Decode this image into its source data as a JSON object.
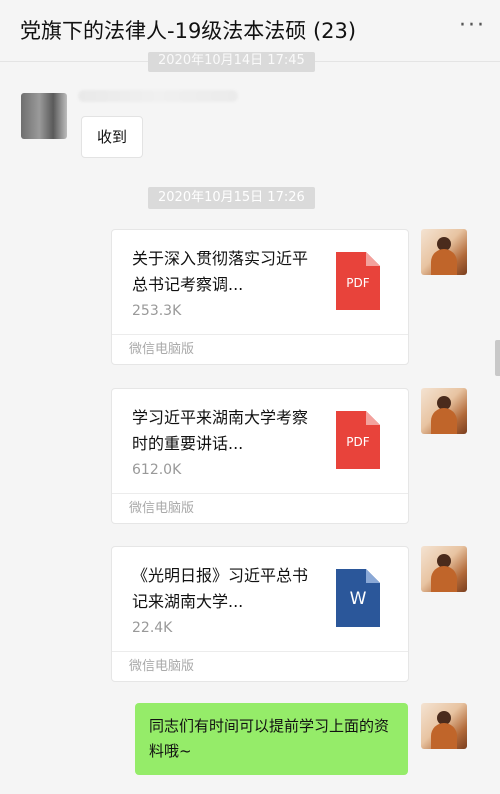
{
  "header": {
    "title": "党旗下的法律人-19级法本法硕 (23)",
    "more": "···"
  },
  "timestamps": {
    "partial": "2020年10月14日 17:45",
    "main": "2020年10月15日 17:26"
  },
  "messages": {
    "first": {
      "text": "收到"
    },
    "files": [
      {
        "name": "关于深入贯彻落实习近平总书记考察调...",
        "size": "253.3K",
        "source": "微信电脑版",
        "icon": "pdf-icon",
        "icon_text": "PDF",
        "icon_color": "#e8433b"
      },
      {
        "name": "学习近平来湖南大学考察时的重要讲话...",
        "size": "612.0K",
        "source": "微信电脑版",
        "icon": "pdf-icon",
        "icon_text": "PDF",
        "icon_color": "#e8433b"
      },
      {
        "name": "《光明日报》习近平总书记来湖南大学...",
        "size": "22.4K",
        "source": "微信电脑版",
        "icon": "word-icon",
        "icon_text": "W",
        "icon_color": "#2b579a"
      }
    ],
    "last": {
      "text": "同志们有时间可以提前学习上面的资料哦~"
    }
  },
  "colors": {
    "bubble_self": "#95ec69",
    "background": "#f5f5f5"
  }
}
